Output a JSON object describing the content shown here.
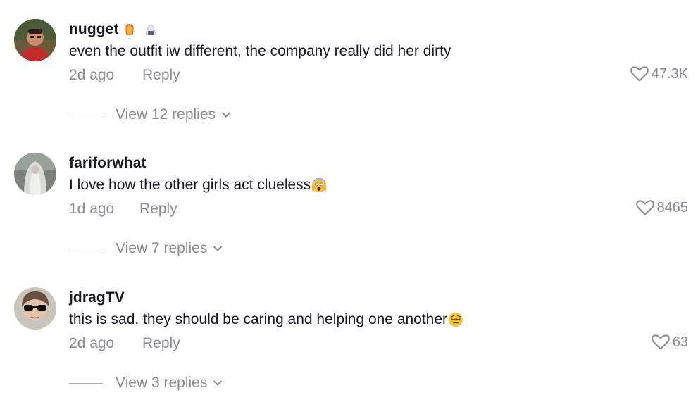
{
  "comments": [
    {
      "username": "nugget",
      "text": "even the outfit iw different, the company really did her dirty",
      "time": "2d ago",
      "reply_label": "Reply",
      "likes": "47.3K",
      "view_replies": "View 12 replies",
      "badges": [
        "raised-hand-emoji",
        "onigiri-emoji"
      ],
      "avatar_icon": "person-red-shirt-avatar"
    },
    {
      "username": "fariforwhat",
      "text": "I love how the other girls act clueless",
      "trailing_emoji": "screaming-face-emoji",
      "time": "1d ago",
      "reply_label": "Reply",
      "likes": "8465",
      "view_replies": "View 7 replies",
      "avatar_icon": "white-hair-figure-avatar"
    },
    {
      "username": "jdragTV",
      "text": "this is sad. they should be caring and helping one another",
      "trailing_emoji": "pensive-face-emoji",
      "time": "2d ago",
      "reply_label": "Reply",
      "likes": "63",
      "view_replies": "View 3 replies",
      "avatar_icon": "person-sunglasses-avatar"
    }
  ],
  "colors": {
    "text": "#161823",
    "muted": "#8a8b91"
  }
}
